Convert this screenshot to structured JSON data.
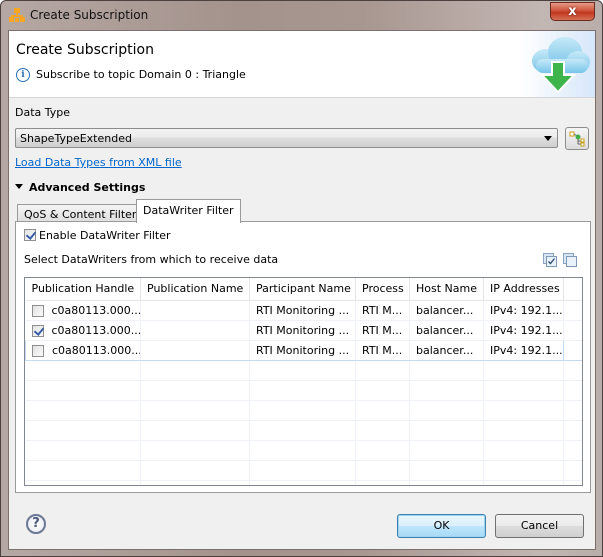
{
  "window": {
    "title": "Create Subscription",
    "close_label": "x"
  },
  "header": {
    "title": "Create Subscription",
    "message": "Subscribe to topic Domain 0 : Triangle",
    "banner_icon": "cloud-download-icon"
  },
  "data_type": {
    "label": "Data Type",
    "selected": "ShapeTypeExtended",
    "load_link": "Load Data Types from XML file"
  },
  "advanced": {
    "label": "Advanced Settings",
    "expanded": true
  },
  "tabs": [
    {
      "label": "QoS & Content Filter",
      "active": false
    },
    {
      "label": "DataWriter Filter",
      "active": true
    }
  ],
  "datawriter_filter": {
    "enable_label": "Enable DataWriter Filter",
    "enable_checked": true,
    "select_label": "Select DataWriters from which to receive data",
    "columns": [
      "Publication Handle",
      "Publication Name",
      "Participant Name",
      "Process",
      "Host Name",
      "IP Addresses"
    ],
    "rows": [
      {
        "checked": false,
        "handle": "c0a80113.000...",
        "pub_name": "",
        "participant": "RTI Monitoring ...",
        "process": "RTI M...",
        "host": "balancer...",
        "ip": "IPv4: 192.1..."
      },
      {
        "checked": true,
        "handle": "c0a80113.000...",
        "pub_name": "",
        "participant": "RTI Monitoring ...",
        "process": "RTI M...",
        "host": "balancer...",
        "ip": "IPv4: 192.1..."
      },
      {
        "checked": false,
        "handle": "c0a80113.000...",
        "pub_name": "",
        "participant": "RTI Monitoring ...",
        "process": "RTI M...",
        "host": "balancer...",
        "ip": "IPv4: 192.1..."
      }
    ]
  },
  "footer": {
    "help_label": "?",
    "ok_label": "OK",
    "cancel_label": "Cancel"
  }
}
